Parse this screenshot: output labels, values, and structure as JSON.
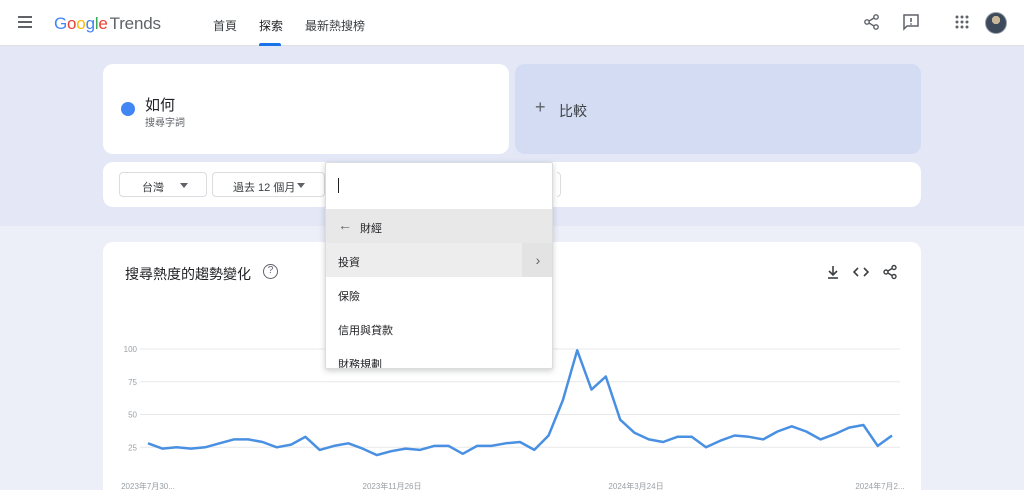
{
  "header": {
    "logo": {
      "google": "Google",
      "trends": "Trends"
    },
    "nav": [
      {
        "label": "首頁"
      },
      {
        "label": "探索"
      },
      {
        "label": "最新熱搜榜"
      }
    ]
  },
  "search_term": {
    "name": "如何",
    "type": "搜尋字詞",
    "color": "#4285f4"
  },
  "compare": {
    "icon": "plus-icon",
    "label": "比較"
  },
  "filters": {
    "region": "台灣",
    "period": "過去 12 個月"
  },
  "category_dropdown": {
    "search_value": "",
    "back_label": "財經",
    "items": [
      {
        "label": "投資",
        "has_children": true
      },
      {
        "label": "保險",
        "has_children": false
      },
      {
        "label": "信用與貸款",
        "has_children": false
      },
      {
        "label": "財務規劃",
        "has_children": false
      }
    ]
  },
  "interest_card": {
    "title": "搜尋熱度的趨勢變化",
    "icons": [
      "download-icon",
      "embed-code-icon",
      "share-icon"
    ]
  },
  "chart_data": {
    "type": "line",
    "title": "搜尋熱度的趨勢變化",
    "ylim": [
      0,
      100
    ],
    "yticks": [
      "25",
      "50",
      "75",
      "100"
    ],
    "xlabels": [
      "2023年7月30...",
      "2023年11月26日",
      "2024年3月24日",
      "2024年7月2..."
    ],
    "series": [
      {
        "name": "如何",
        "color": "#4a90e2",
        "values": [
          28,
          24,
          25,
          24,
          25,
          28,
          31,
          31,
          29,
          25,
          27,
          33,
          23,
          26,
          28,
          24,
          19,
          22,
          24,
          23,
          26,
          26,
          20,
          26,
          26,
          28,
          29,
          23,
          34,
          61,
          99,
          69,
          79,
          46,
          36,
          31,
          29,
          33,
          33,
          25,
          30,
          34,
          33,
          31,
          37,
          41,
          37,
          31,
          35,
          40,
          42,
          26,
          34
        ]
      }
    ],
    "grid": true
  }
}
